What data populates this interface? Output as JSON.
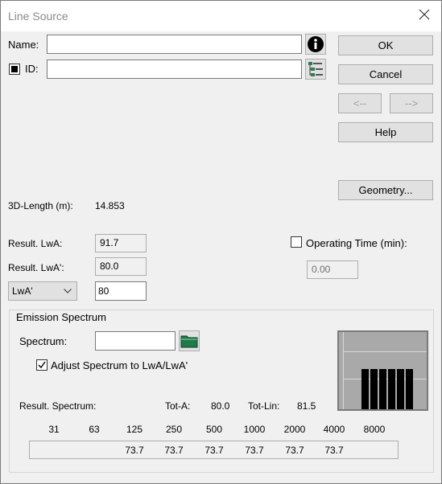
{
  "window": {
    "title": "Line Source"
  },
  "form": {
    "name_label": "Name:",
    "name_value": "",
    "id_label": "ID:",
    "id_value": ""
  },
  "buttons": {
    "ok": "OK",
    "cancel": "Cancel",
    "prev": "<--",
    "next": "-->",
    "help": "Help",
    "geometry": "Geometry..."
  },
  "info": {
    "length_label": "3D-Length (m):",
    "length_value": "14.853",
    "lwa_label": "Result. LwA:",
    "lwa_value": "91.7",
    "lwa_prime_label": "Result. LwA':",
    "lwa_prime_value": "80.0",
    "mode_select": "LwA'",
    "mode_value": "80"
  },
  "operating_time": {
    "label": "Operating Time (min):",
    "value": "0.00",
    "checked": false
  },
  "emission": {
    "group_label": "Emission Spectrum",
    "spectrum_label": "Spectrum:",
    "spectrum_value": "",
    "adjust_label": "Adjust Spectrum to LwA/LwA'",
    "adjust_checked": true,
    "result_label": "Result. Spectrum:",
    "tot_a_label": "Tot-A:",
    "tot_a_value": "80.0",
    "tot_lin_label": "Tot-Lin:",
    "tot_lin_value": "81.5",
    "frequencies": [
      "31",
      "63",
      "125",
      "250",
      "500",
      "1000",
      "2000",
      "4000",
      "8000"
    ],
    "values": [
      "",
      "",
      "73.7",
      "73.7",
      "73.7",
      "73.7",
      "73.7",
      "73.7",
      ""
    ]
  },
  "colors": {
    "window_bg": "#f0f0f0",
    "title_text": "#8a8a8a",
    "chart_bar": "#000000"
  }
}
